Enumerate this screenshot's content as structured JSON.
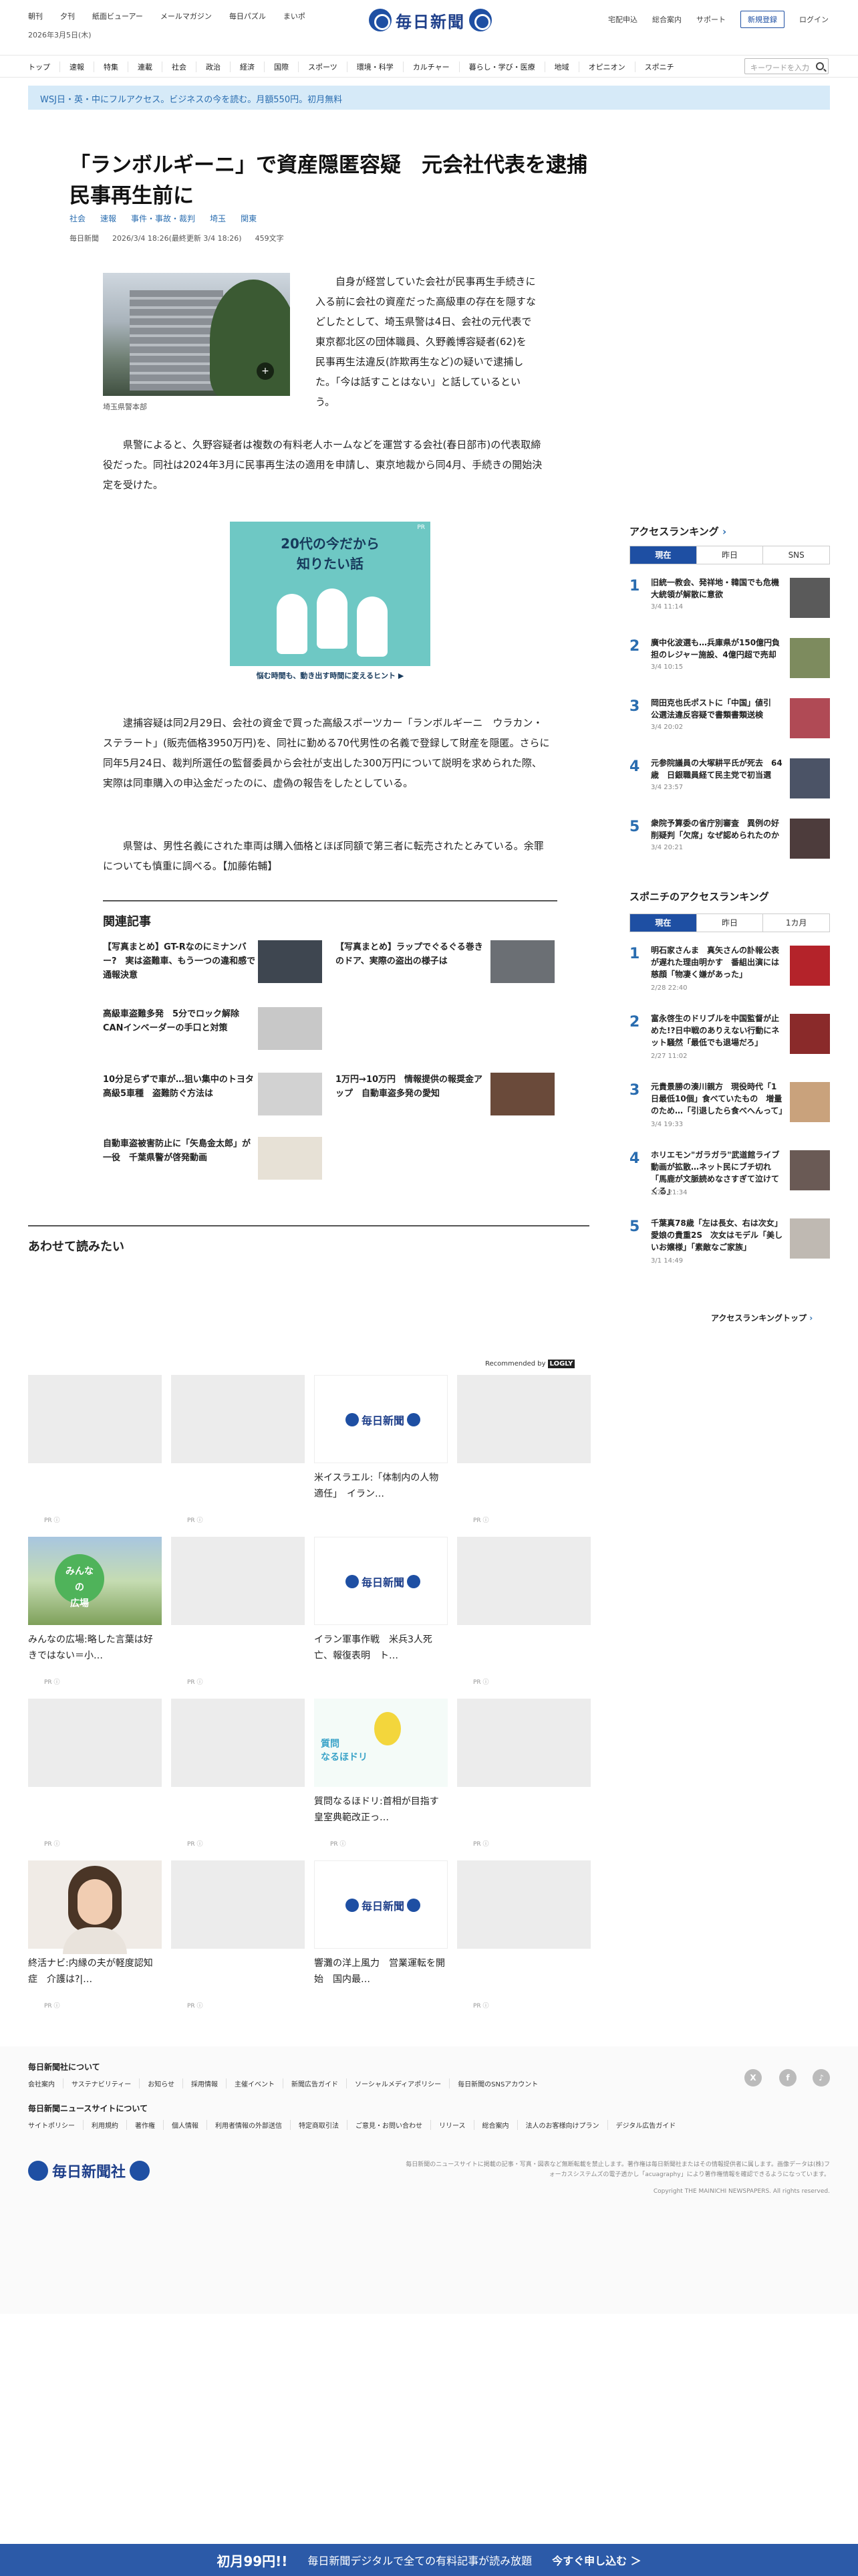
{
  "header": {
    "left_links": [
      "朝刊",
      "夕刊",
      "紙面ビューアー",
      "メールマガジン",
      "毎日パズル",
      "まいポ"
    ],
    "date": "2026年3月5日(木)",
    "logo": "毎日新聞",
    "right_links": [
      "宅配申込",
      "総合案内",
      "サポート"
    ],
    "register": "新規登録",
    "login": "ログイン",
    "nav": [
      "トップ",
      "速報",
      "特集",
      "連載",
      "社会",
      "政治",
      "経済",
      "国際",
      "スポーツ",
      "環境・科学",
      "カルチャー",
      "暮らし・学び・医療",
      "地域",
      "オピニオン",
      "スポニチ"
    ],
    "search_placeholder": "キーワードを入力"
  },
  "promo": "WSJ日・英・中にフルアクセス。ビジネスの今を読む。月額550円。初月無料",
  "article": {
    "title": "「ランボルギーニ」で資産隠匿容疑　元会社代表を逮捕　民事再生前に",
    "tags": [
      "社会",
      "速報",
      "事件・事故・裁判",
      "埼玉",
      "関東"
    ],
    "source": "毎日新聞",
    "published": "2026/3/4 18:26(最終更新 3/4 18:26)",
    "chars": "459文字",
    "photo_caption": "埼玉県警本部",
    "p1": "自身が経営していた会社が民事再生手続きに入る前に会社の資産だった高級車の存在を隠すなどしたとして、埼玉県警は4日、会社の元代表で東京都北区の団体職員、久野義博容疑者(62)を民事再生法違反(詐欺再生など)の疑いで逮捕した。「今は話すことはない」と話しているという。",
    "p2": "県警によると、久野容疑者は複数の有料老人ホームなどを運営する会社(春日部市)の代表取締役だった。同社は2024年3月に民事再生法の適用を申請し、東京地裁から同4月、手続きの開始決定を受けた。",
    "ad_title": "20代の今だから\n知りたい話",
    "ad_footer": "悩む時間も、動き出す時間に変えるヒント ▶",
    "ad_badge": "PR",
    "p3": "逮捕容疑は同2月29日、会社の資金で買った高級スポーツカー「ランボルギーニ　ウラカン・ステラート」(販売価格3950万円)を、同社に勤める70代男性の名義で登録して財産を隠匿。さらに同年5月24日、裁判所選任の監督委員から会社が支出した300万円について説明を求められた際、実際は同車購入の申込金だったのに、虚偽の報告をしたとしている。",
    "p4": "県警は、男性名義にされた車両は購入価格とほぼ同額で第三者に転売されたとみている。余罪についても慎重に調べる。【加藤佑輔】"
  },
  "related": {
    "heading": "関連記事",
    "items": [
      {
        "title": "【写真まとめ】GT-Rなのにミナンバー?　実は盗難車、もう一つの違和感で通報決意"
      },
      {
        "title": "【写真まとめ】ラップでぐるぐる巻きのドア、実際の盗出の様子は"
      },
      {
        "title": "高級車盗難多発　5分でロック解除　CANインベーダーの手口と対策"
      },
      {
        "title": "10分足らずで車が…狙い集中のトヨタ高級5車種　盗難防ぐ方法は"
      },
      {
        "title": "1万円→10万円　情報提供の報奨金アップ　自動車盗多発の愛知"
      },
      {
        "title": "自動車盗被害防止に「矢島金太郎」が一役　千葉県警が啓発動画"
      }
    ]
  },
  "also_read": {
    "heading": "あわせて読みたい",
    "recommended_by": "Recommended by",
    "recommended_brand": "LOGLY",
    "pr": "PR ⓘ",
    "cards": [
      {
        "title": ""
      },
      {
        "title": ""
      },
      {
        "title": "米イスラエル:「体制内の人物適任」　イラン…"
      },
      {
        "title": ""
      },
      {
        "title": "みんなの広場:略した言葉は好きではない＝小…"
      },
      {
        "title": ""
      },
      {
        "title": "イラン軍事作戦　米兵3人死亡、報復表明　ト…"
      },
      {
        "title": ""
      },
      {
        "title": ""
      },
      {
        "title": ""
      },
      {
        "title": "質問なるほドリ:首相が目指す皇室典範改正っ…"
      },
      {
        "title": ""
      },
      {
        "title": "終活ナビ:内縁の夫が軽度認知症　介護は?|…"
      },
      {
        "title": ""
      },
      {
        "title": "響灘の洋上風力　営業運転を開始　国内最…"
      },
      {
        "title": ""
      }
    ],
    "logo_text": "毎日新聞",
    "bubble_text": "みんな\nの\n広場",
    "bird_text": "質問\nなるほドリ"
  },
  "sidebar": {
    "ranking_heading": "アクセスランキング",
    "tabs1": [
      "現在",
      "昨日",
      "SNS"
    ],
    "ranking": [
      {
        "n": "1",
        "title": "旧統一教会、発祥地・韓国でも危機　大統領が解散に意欲",
        "date": "3/4 11:14"
      },
      {
        "n": "2",
        "title": "廣中化波選も…兵庫県が150億円負担のレジャー施設、4億円超で売却",
        "date": "3/4 10:15"
      },
      {
        "title": "岡田克也氏ポストに「中国」値引　公選法違反容疑で書類書類送検",
        "n": "3",
        "date": "3/4 20:02"
      },
      {
        "n": "4",
        "title": "元参院議員の大塚耕平氏が死去　64歳　日銀職員経て民主党で初当選",
        "date": "3/4 23:57"
      },
      {
        "n": "5",
        "title": "衆院予算委の省庁別審査　異例の好削疑判「欠席」なぜ認められたのか",
        "date": "3/4 20:21"
      }
    ],
    "sponichi_heading": "スポニチのアクセスランキング",
    "tabs2": [
      "現在",
      "昨日",
      "1カ月"
    ],
    "sponichi": [
      {
        "n": "1",
        "title": "明石家さんま　真矢さんの訃報公表が遅れた理由明かす　番組出演には慈顔「物凄く嫌があった」",
        "date": "2/28 22:40"
      },
      {
        "n": "2",
        "title": "富永啓生のドリブルを中国監督が止めた!?日中戦のありえない行動にネット騒然「最低でも退場だろ」",
        "date": "2/27 11:02"
      },
      {
        "n": "3",
        "title": "元貴景勝の湊川親方　現役時代「1日最低10個」食べていたもの　増量のため…「引退したら食べへんって」",
        "date": "3/4 19:33"
      },
      {
        "n": "4",
        "title": "ホリエモン\"ガラガラ\"武道館ライブ動画が拡散…ネット民にブチ切れ「馬鹿が文脈読めなさすぎて泣けてくる」",
        "date": "2/27 21:34"
      },
      {
        "n": "5",
        "title": "千葉真78歳「左は長女、右は次女」愛娘の貴重2S　次女はモデル「美しいお嬢様」「素敵なご家族」",
        "date": "3/1 14:49"
      }
    ],
    "more": "アクセスランキングトップ"
  },
  "footer": {
    "h1": "毎日新聞社について",
    "links1": [
      "会社案内",
      "サステナビリティー",
      "お知らせ",
      "採用情報",
      "主催イベント",
      "新聞広告ガイド",
      "ソーシャルメディアポリシー",
      "毎日新聞のSNSアカウント"
    ],
    "h2": "毎日新聞ニュースサイトについて",
    "links2": [
      "サイトポリシー",
      "利用規約",
      "著作権",
      "個人情報",
      "利用者情報の外部送信",
      "特定商取引法",
      "ご意見・お問い合わせ",
      "リリース",
      "総合案内",
      "法人のお客様向けプラン",
      "デジタル広告ガイド"
    ],
    "social": [
      "X",
      "f",
      "♪"
    ],
    "logo": "毎日新聞社",
    "note": "毎日新聞のニュースサイトに掲載の記事・写真・図表など無断転載を禁止します。著作権は毎日新聞社またはその情報提供者に属します。画像データは(株)フォーカスシステムズの電子透かし「acuagraphy」により著作権情報を確認できるようになっています。",
    "copyright": "Copyright THE MAINICHI NEWSPAPERS. All rights reserved."
  },
  "cta": {
    "offer": "初月99円!!",
    "text": "毎日新聞デジタルで全ての有料記事が読み放題",
    "action": "今すぐ申し込む ＞"
  },
  "colors": {
    "brand": "#1e4fa3",
    "link": "#2a6db0",
    "cta": "#2c5aa8"
  }
}
